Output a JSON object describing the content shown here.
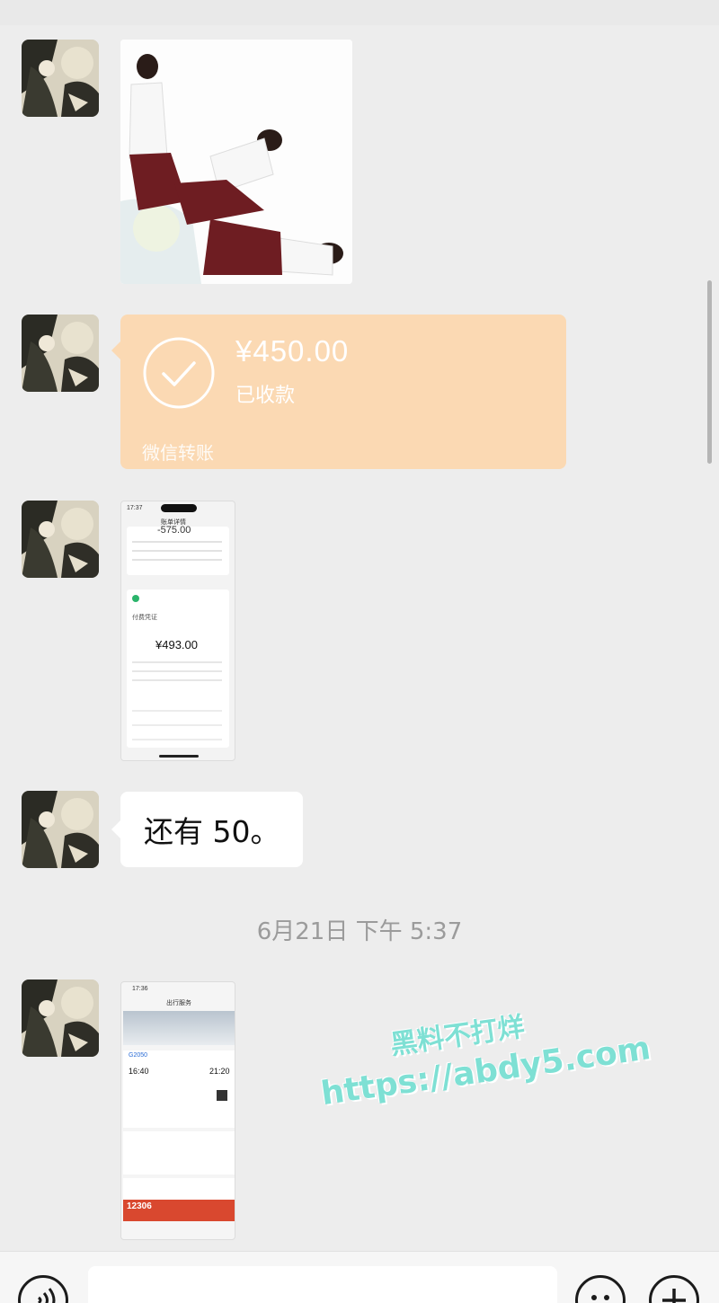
{
  "transfer": {
    "amount": "¥450.00",
    "status": "已收款",
    "footer": "微信转账"
  },
  "screenshot1": {
    "time": "17:37",
    "title": "账单详情",
    "partial_amount": "-575.00",
    "label": "付费凭证",
    "amount": "¥493.00"
  },
  "message_text": "还有 50。",
  "timestamp": "6月21日 下午 5:37",
  "screenshot2": {
    "time": "17:36",
    "title": "出行服务",
    "train": "G2050",
    "depart": "16:40",
    "arrive": "21:20",
    "banner": "12306"
  },
  "watermark": {
    "line1": "黑料不打烊",
    "line2": "https://abdy5.com"
  },
  "colors": {
    "background": "#ededed",
    "transfer_bubble": "#fbd9b3",
    "watermark": "#7ee0d4"
  },
  "icons": {
    "voice": "voice-icon",
    "emoji": "emoji-icon",
    "plus": "plus-icon",
    "check": "check-circle-icon"
  }
}
